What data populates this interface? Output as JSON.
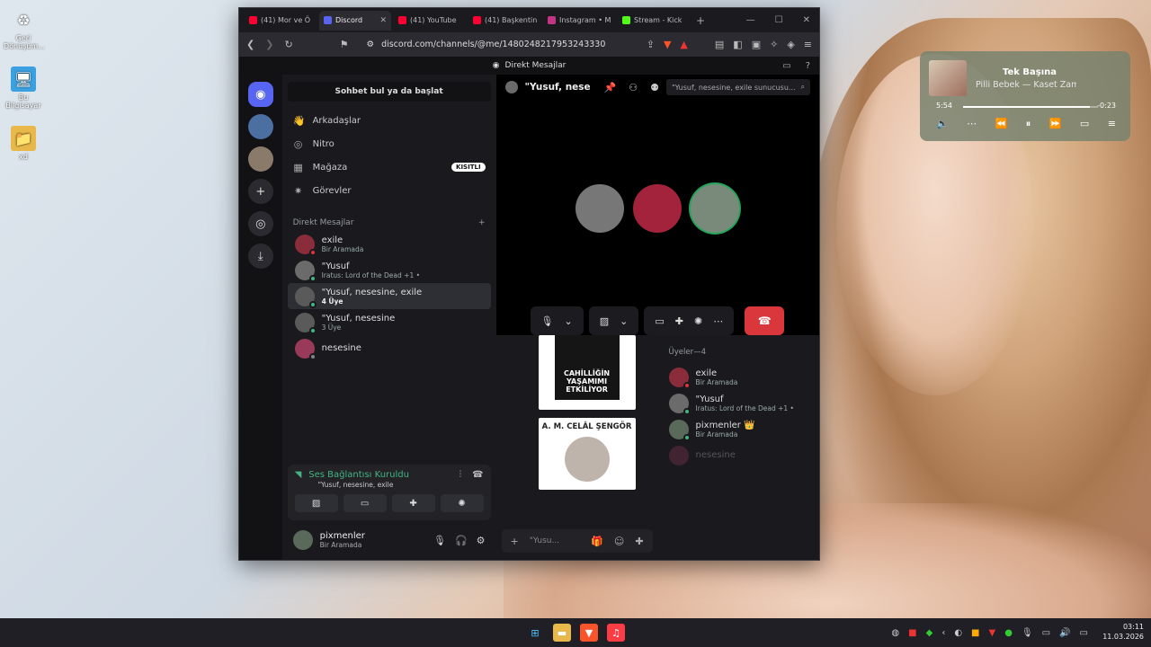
{
  "desktop": {
    "icons": [
      {
        "label": "Geri Dönüşüm...",
        "glyph": "♻"
      },
      {
        "label": "Bu Bilgisayar",
        "glyph": "🖥"
      },
      {
        "label": "xd",
        "glyph": "📁"
      }
    ]
  },
  "browser": {
    "tabs": [
      {
        "label": "(41) Mor ve Ö",
        "color": "#ff0033"
      },
      {
        "label": "Discord",
        "color": "#5865f2",
        "active": true
      },
      {
        "label": "(41) YouTube",
        "color": "#ff0033"
      },
      {
        "label": "(41) Başkentin",
        "color": "#ff0033"
      },
      {
        "label": "Instagram • M",
        "color": "#c13584"
      },
      {
        "label": "Stream - Kick",
        "color": "#53fc18"
      }
    ],
    "url": "discord.com/channels/@me/1480248217953243330",
    "window_title": "Direkt Mesajlar"
  },
  "sidebar": {
    "search_label": "Sohbet bul ya da başlat",
    "nav": [
      {
        "label": "Arkadaşlar",
        "icon": "friends-icon",
        "glyph": "👋"
      },
      {
        "label": "Nitro",
        "icon": "nitro-icon",
        "glyph": "◎"
      },
      {
        "label": "Mağaza",
        "icon": "shop-icon",
        "glyph": "▦",
        "badge": "KISITLI"
      },
      {
        "label": "Görevler",
        "icon": "quests-icon",
        "glyph": "✷"
      }
    ],
    "dm_header": "Direkt Mesajlar",
    "dms": [
      {
        "name": "exile",
        "sub": "Bir Aramada",
        "color": "#8b2c3a",
        "status": "#da373c"
      },
      {
        "name": "\"Yusuf",
        "sub": "Iratus: Lord of the Dead +1 •",
        "color": "#6b6b6b",
        "status": "#43b581"
      },
      {
        "name": "\"Yusuf, nesesine, exile",
        "sub": "4 Üye",
        "color": "#5a5a5a",
        "status": "#43b581",
        "active": true
      },
      {
        "name": "\"Yusuf, nesesine",
        "sub": "3 Üye",
        "color": "#5a5a5a",
        "status": "#43b581"
      },
      {
        "name": "nesesine",
        "sub": "",
        "color": "#9a3a5a",
        "status": "#80848e"
      }
    ],
    "voice": {
      "status": "Ses Bağlantısı Kuruldu",
      "channel": "\"Yusuf, nesesine, exile"
    },
    "user": {
      "name": "pixmenler",
      "sub": "Bir Aramada"
    }
  },
  "channel": {
    "title": "\"Yusuf, nesesine, exile",
    "search_placeholder": "\"Yusuf, nesesine, exile sunucusu..."
  },
  "call": {
    "participants": [
      {
        "color": "#777777",
        "muted": true
      },
      {
        "color": "#a4233c",
        "muted": true
      },
      {
        "color": "#7a8a7a",
        "muted": false
      }
    ]
  },
  "chat": {
    "book1_title": "CAHİLLİĞİN YAŞAMIMI ETKİLİYOR",
    "book2_title": "A. M. CELÂL ŞENGÖR",
    "input_placeholder": "\"Yusu..."
  },
  "members": {
    "header": "Üyeler—4",
    "list": [
      {
        "name": "exile",
        "sub": "Bir Aramada",
        "color": "#8b2c3a",
        "status": "#da373c"
      },
      {
        "name": "\"Yusuf",
        "sub": "Iratus: Lord of the Dead +1 •",
        "color": "#6b6b6b",
        "status": "#43b581"
      },
      {
        "name": "pixmenler 👑",
        "sub": "Bir Aramada",
        "color": "#5a6a5a",
        "status": "#43b581"
      },
      {
        "name": "nesesine",
        "sub": "",
        "color": "#9a3a5a",
        "status": "#80848e",
        "offline": true
      }
    ]
  },
  "media": {
    "title": "Tek Başına",
    "artist": "Pilli Bebek — Kaset Zamanı",
    "elapsed": "5:54",
    "remaining": "-0:23",
    "progress": 0.94
  },
  "clock": {
    "time": "03:11",
    "date": "11.03.2026"
  }
}
